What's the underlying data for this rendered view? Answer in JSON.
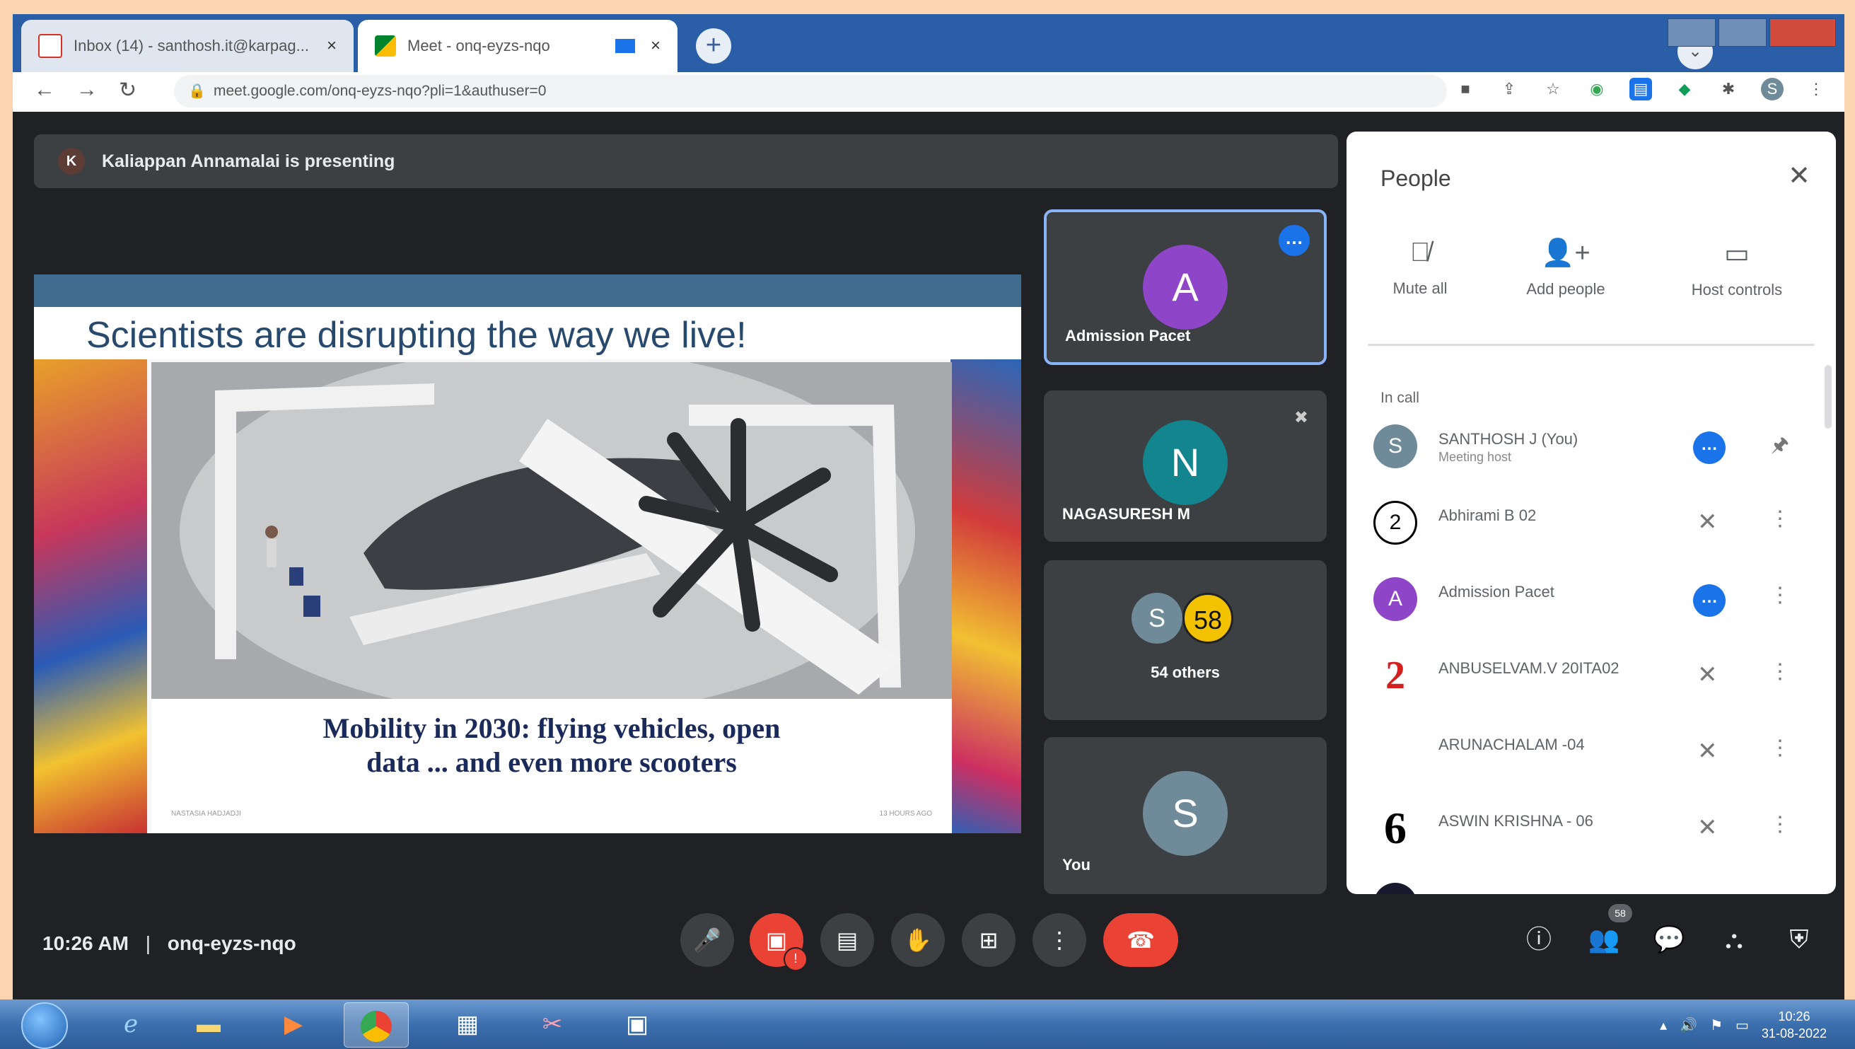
{
  "browser": {
    "tabs": [
      {
        "title": "Inbox (14) - santhosh.it@karpag...",
        "close": "×"
      },
      {
        "title": "Meet - onq-eyzs-nqo",
        "close": "×"
      }
    ],
    "new_tab": "+",
    "url": "meet.google.com/onq-eyzs-nqo?pli=1&authuser=0"
  },
  "meet": {
    "presenter_initial": "K",
    "presenting_text": "Kaliappan Annamalai is presenting",
    "slide": {
      "title": "Scientists are disrupting the way we live!",
      "caption_line1": "Mobility in 2030: flying vehicles, open",
      "caption_line2": "data ... and even more scooters",
      "meta_left": "NASTASIA HADJADJI",
      "meta_right": "13 HOURS AGO"
    },
    "tiles": [
      {
        "initial": "A",
        "name": "Admission Pacet",
        "color": "#8e45c8"
      },
      {
        "initial": "N",
        "name": "NAGASURESH M",
        "color": "#12858f"
      },
      {
        "mini_initial": "S",
        "mini_count": "58",
        "name": "54 others"
      },
      {
        "initial": "S",
        "name": "You",
        "color": "#6f8a98"
      }
    ],
    "time": "10:26 AM",
    "separator": "|",
    "meeting_code": "onq-eyzs-nqo",
    "people_badge": "58"
  },
  "people_panel": {
    "title": "People",
    "actions": [
      {
        "label": "Mute all",
        "icon": "mic-off-icon"
      },
      {
        "label": "Add people",
        "icon": "add-person-icon"
      },
      {
        "label": "Host controls",
        "icon": "host-controls-icon"
      }
    ],
    "section": "In call",
    "participants": [
      {
        "initial": "S",
        "name": "SANTHOSH J (You)",
        "sub": "Meeting host",
        "color": "#6f8a98",
        "status": "more"
      },
      {
        "initial": "2",
        "name": "Abhirami B 02",
        "sub": "",
        "color": "#ffffff",
        "status": "muted"
      },
      {
        "initial": "A",
        "name": "Admission Pacet",
        "sub": "",
        "color": "#8e45c8",
        "status": "more"
      },
      {
        "initial": "2",
        "name": "ANBUSELVAM.V 20ITA02",
        "sub": "",
        "color": "#ffffff",
        "status": "muted"
      },
      {
        "initial": "",
        "name": "ARUNACHALAM -04",
        "sub": "",
        "color": "#ffffff",
        "status": "muted"
      },
      {
        "initial": "6",
        "name": "ASWIN KRISHNA - 06",
        "sub": "",
        "color": "#ffffff",
        "status": "muted"
      }
    ]
  },
  "taskbar": {
    "clock_time": "10:26",
    "clock_date": "31-08-2022"
  }
}
